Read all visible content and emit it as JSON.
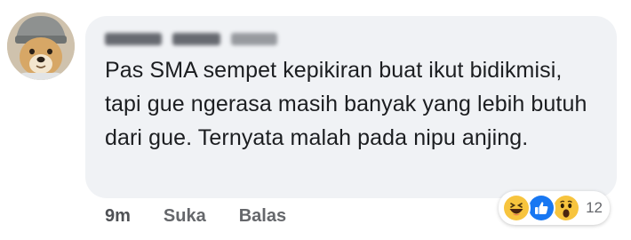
{
  "comment": {
    "text": "Pas SMA sempet kepikiran buat ikut bidikmisi, tapi gue ngerasa masih banyak yang lebih butuh dari gue. Ternyata malah pada nipu anjing."
  },
  "actions": {
    "time": "9m",
    "like_label": "Suka",
    "reply_label": "Balas"
  },
  "reactions": {
    "icons": [
      "haha-icon",
      "like-icon",
      "wow-icon"
    ],
    "count": "12"
  },
  "colors": {
    "bubble": "#f0f2f5",
    "text": "#1c1e21",
    "meta": "#65676b",
    "like_blue": "#1877f2",
    "emoji_yellow": "#f7c43e"
  }
}
